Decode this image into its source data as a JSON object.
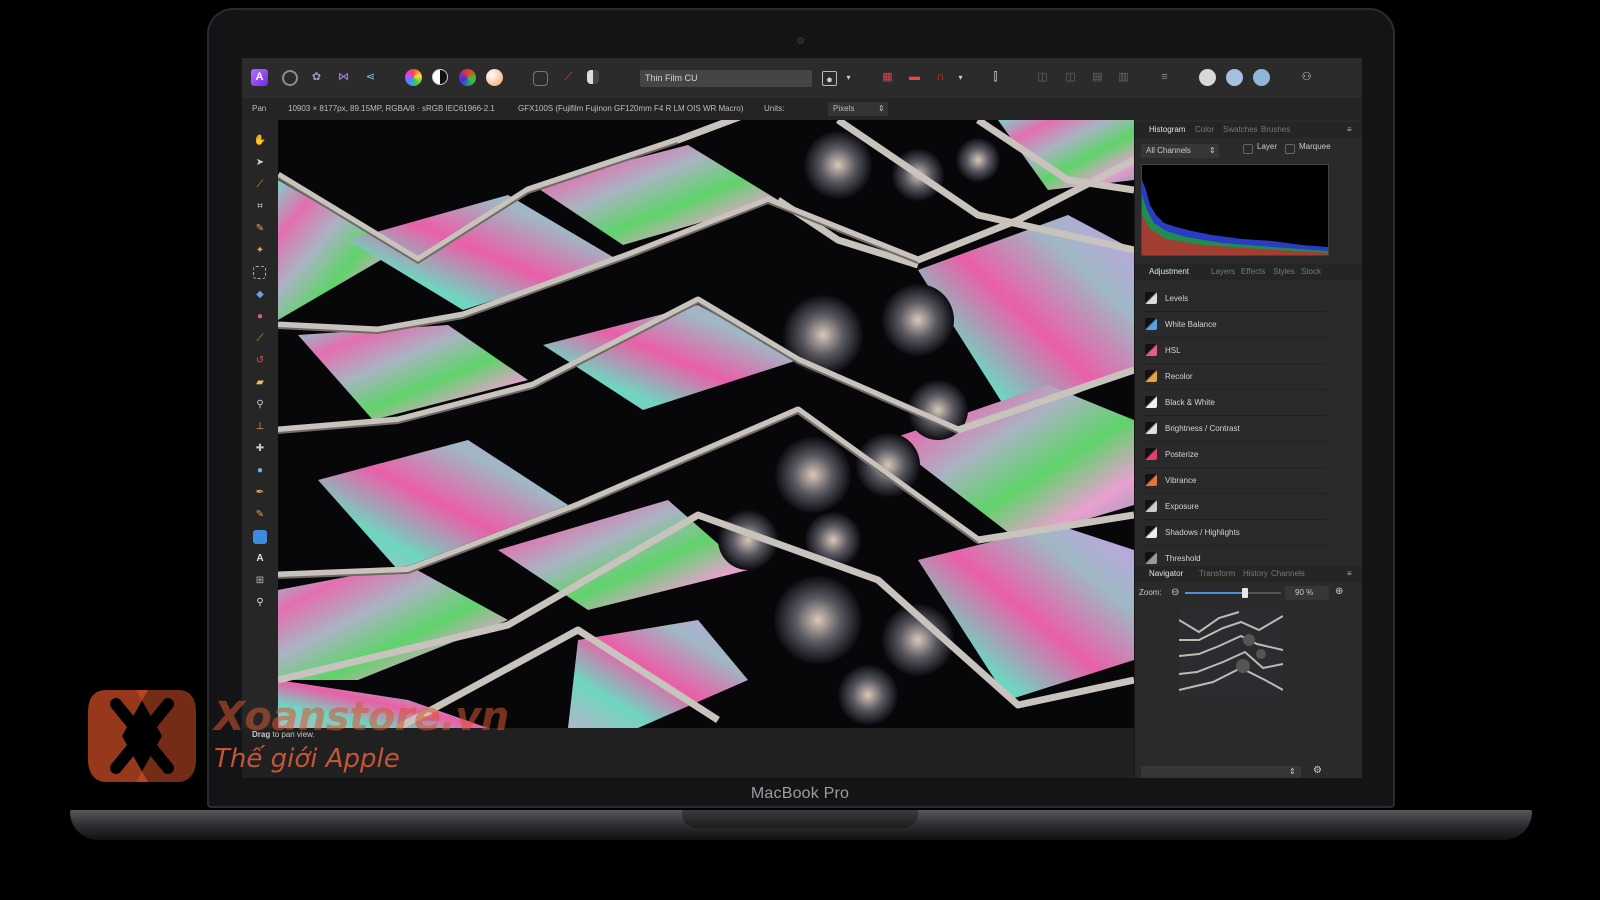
{
  "device": {
    "label": "MacBook Pro"
  },
  "toolbar": {
    "style_field": "Thin Film CU",
    "icons": [
      "photo-persona-icon",
      "liquify-persona-icon",
      "develop-persona-icon",
      "tone-mapping-persona-icon",
      "export-persona-icon",
      "color-picker-icon",
      "auto-contrast-icon",
      "auto-colors-icon",
      "white-balance-icon",
      "marquee-icon",
      "pen-icon",
      "mask-icon",
      "snapping-icon",
      "assistant-icon",
      "quick-mask-icon",
      "brush-icon",
      "arrange-icon",
      "account-icon"
    ]
  },
  "context_bar": {
    "tool": "Pan",
    "doc_info": "10903 × 8177px, 89.15MP, RGBA/8 · sRGB IEC61966-2.1",
    "lens_info": "GFX100S (Fujifilm Fujinon GF120mm F4 R LM OIS WR Macro)",
    "units_label": "Units:",
    "units_value": "Pixels"
  },
  "status": {
    "hint_bold": "Drag",
    "hint_rest": "to pan view."
  },
  "histogram_panel": {
    "tabs": [
      "Histogram",
      "Color",
      "Swatches",
      "Brushes"
    ],
    "channel_select": "All Channels",
    "layer_label": "Layer",
    "marquee_label": "Marquee"
  },
  "adjustment_panel": {
    "tabs": [
      "Adjustment",
      "Layers",
      "Effects",
      "Styles",
      "Stock"
    ],
    "items": [
      {
        "label": "Levels",
        "color": "#dddddd"
      },
      {
        "label": "White Balance",
        "color": "#5aa0e8"
      },
      {
        "label": "HSL",
        "color": "#e85b8f"
      },
      {
        "label": "Recolor",
        "color": "#e8a440"
      },
      {
        "label": "Black & White",
        "color": "#f0f0f0"
      },
      {
        "label": "Brightness / Contrast",
        "color": "#e0e0e0"
      },
      {
        "label": "Posterize",
        "color": "#e0406a"
      },
      {
        "label": "Vibrance",
        "color": "#e8743a"
      },
      {
        "label": "Exposure",
        "color": "#cccccc"
      },
      {
        "label": "Shadows / Highlights",
        "color": "#eeeeee"
      },
      {
        "label": "Threshold",
        "color": "#9a9a9a"
      }
    ]
  },
  "navigator_panel": {
    "tabs": [
      "Navigator",
      "Transform",
      "History",
      "Channels"
    ],
    "zoom_label": "Zoom:",
    "zoom_value": "90 %",
    "zoom_fraction": 0.62
  },
  "watermark": {
    "brand": "Xoanstore.vn",
    "tagline": "Thế giới Apple"
  }
}
